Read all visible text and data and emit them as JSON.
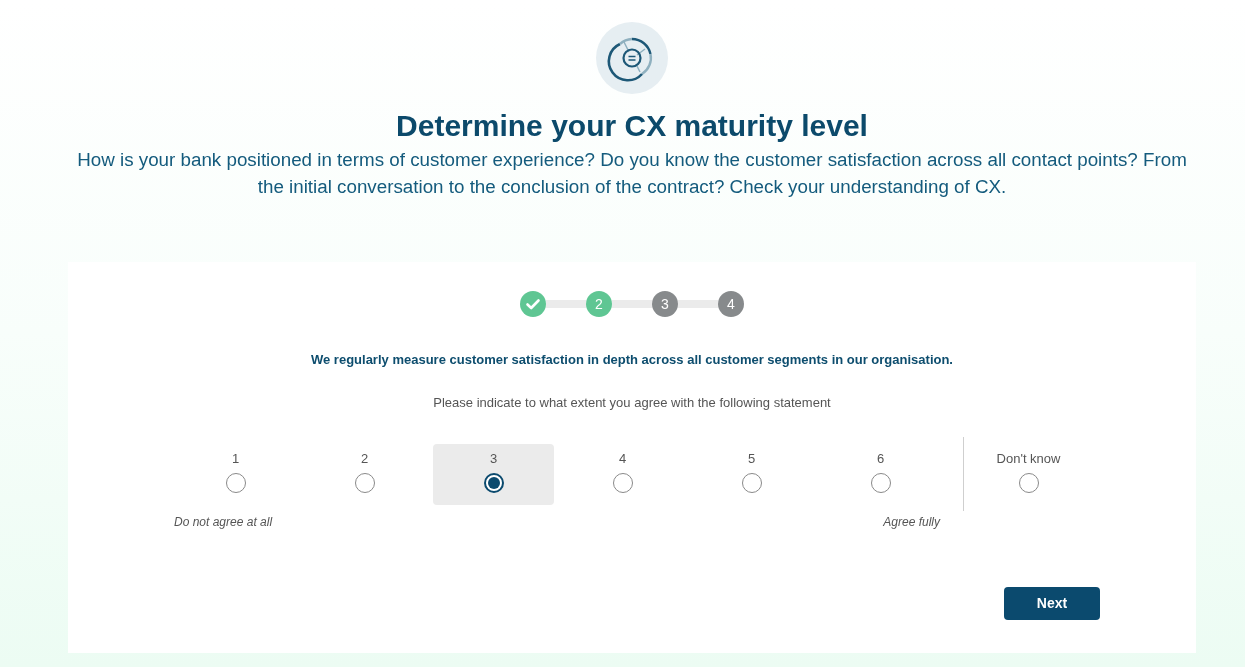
{
  "header": {
    "title": "Determine your CX maturity level",
    "description": "How is your bank positioned in terms of customer experience? Do you know the customer satisfaction across all contact points? From the initial conversation to the conclusion of the contract? Check your understanding of CX."
  },
  "stepper": {
    "steps": [
      {
        "completed": true
      },
      {
        "label": "2",
        "completed": false,
        "current": true
      },
      {
        "label": "3",
        "completed": false,
        "current": false
      },
      {
        "label": "4",
        "completed": false,
        "current": false
      }
    ]
  },
  "question": {
    "statement": "We regularly measure customer satisfaction in depth across all customer segments in our organisation.",
    "instruction": "Please indicate to what extent you agree with the following statement",
    "options": [
      {
        "label": "1",
        "selected": false
      },
      {
        "label": "2",
        "selected": false
      },
      {
        "label": "3",
        "selected": true
      },
      {
        "label": "4",
        "selected": false
      },
      {
        "label": "5",
        "selected": false
      },
      {
        "label": "6",
        "selected": false
      }
    ],
    "dont_know": {
      "label": "Don't know",
      "selected": false
    },
    "scale_low": "Do not agree at all",
    "scale_high": "Agree fully"
  },
  "next_button": "Next"
}
